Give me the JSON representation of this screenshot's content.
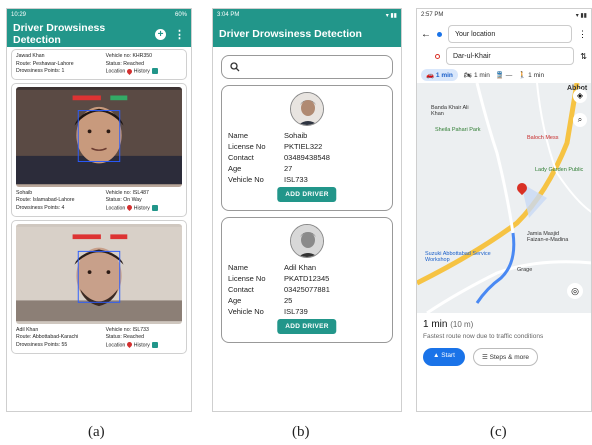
{
  "captions": [
    "(a)",
    "(b)",
    "(c)"
  ],
  "panel_a": {
    "status_time": "10:29",
    "status_right": "60%",
    "title": "Driver Drowsiness Detection",
    "location_label": "Location",
    "history_label": "History",
    "cards": [
      {
        "name": "Jawad Khan",
        "vehicle": "Vehicle no: KHR350",
        "route": "Route: Peshawar-Lahore",
        "status": "Status: Reached",
        "points": "Drowsiness Points: 1",
        "has_photo": false
      },
      {
        "name": "Sohaib",
        "vehicle": "Vehicle no: ISL487",
        "route": "Route: Islamabad-Lahore",
        "status": "Status: On Way",
        "points": "Drowsiness Points: 4",
        "has_photo": true
      },
      {
        "name": "Adil Khan",
        "vehicle": "Vehicle no: ISL733",
        "route": "Route: Abbottabad-Karachi",
        "status": "Status: Reached",
        "points": "Drowsiness Points: 55",
        "has_photo": true
      }
    ]
  },
  "panel_b": {
    "status_time": "3:04 PM",
    "title": "Driver Drowsiness Detection",
    "search_placeholder": "",
    "field_labels": [
      "Name",
      "License No",
      "Contact",
      "Age",
      "Vehicle No"
    ],
    "add_button": "ADD DRIVER",
    "drivers": [
      {
        "values": [
          "Sohaib",
          "PKTIEL322",
          "03489438548",
          "27",
          "ISL733"
        ]
      },
      {
        "values": [
          "Adil Khan",
          "PKATD12345",
          "03425077881",
          "25",
          "ISL739"
        ]
      }
    ]
  },
  "panel_c": {
    "status_time": "2:57 PM",
    "from": "Your location",
    "to": "Dar-ul-Khair",
    "modes": [
      "1 min",
      "1 min",
      "—",
      "1 min"
    ],
    "map_labels": [
      "Abbot",
      "Banda Khair Ali Khan",
      "Sheila Pahari Park",
      "Baloch Mess",
      "Lady Garden Public",
      "Jamia Masjid Faizan-e-Madina",
      "Suzuki Abbottabad Service Workshop",
      "Grage"
    ],
    "eta": "1 min",
    "distance": "(10 m)",
    "note": "Fastest route now due to traffic conditions",
    "start": "Start",
    "steps": "Steps & more"
  }
}
